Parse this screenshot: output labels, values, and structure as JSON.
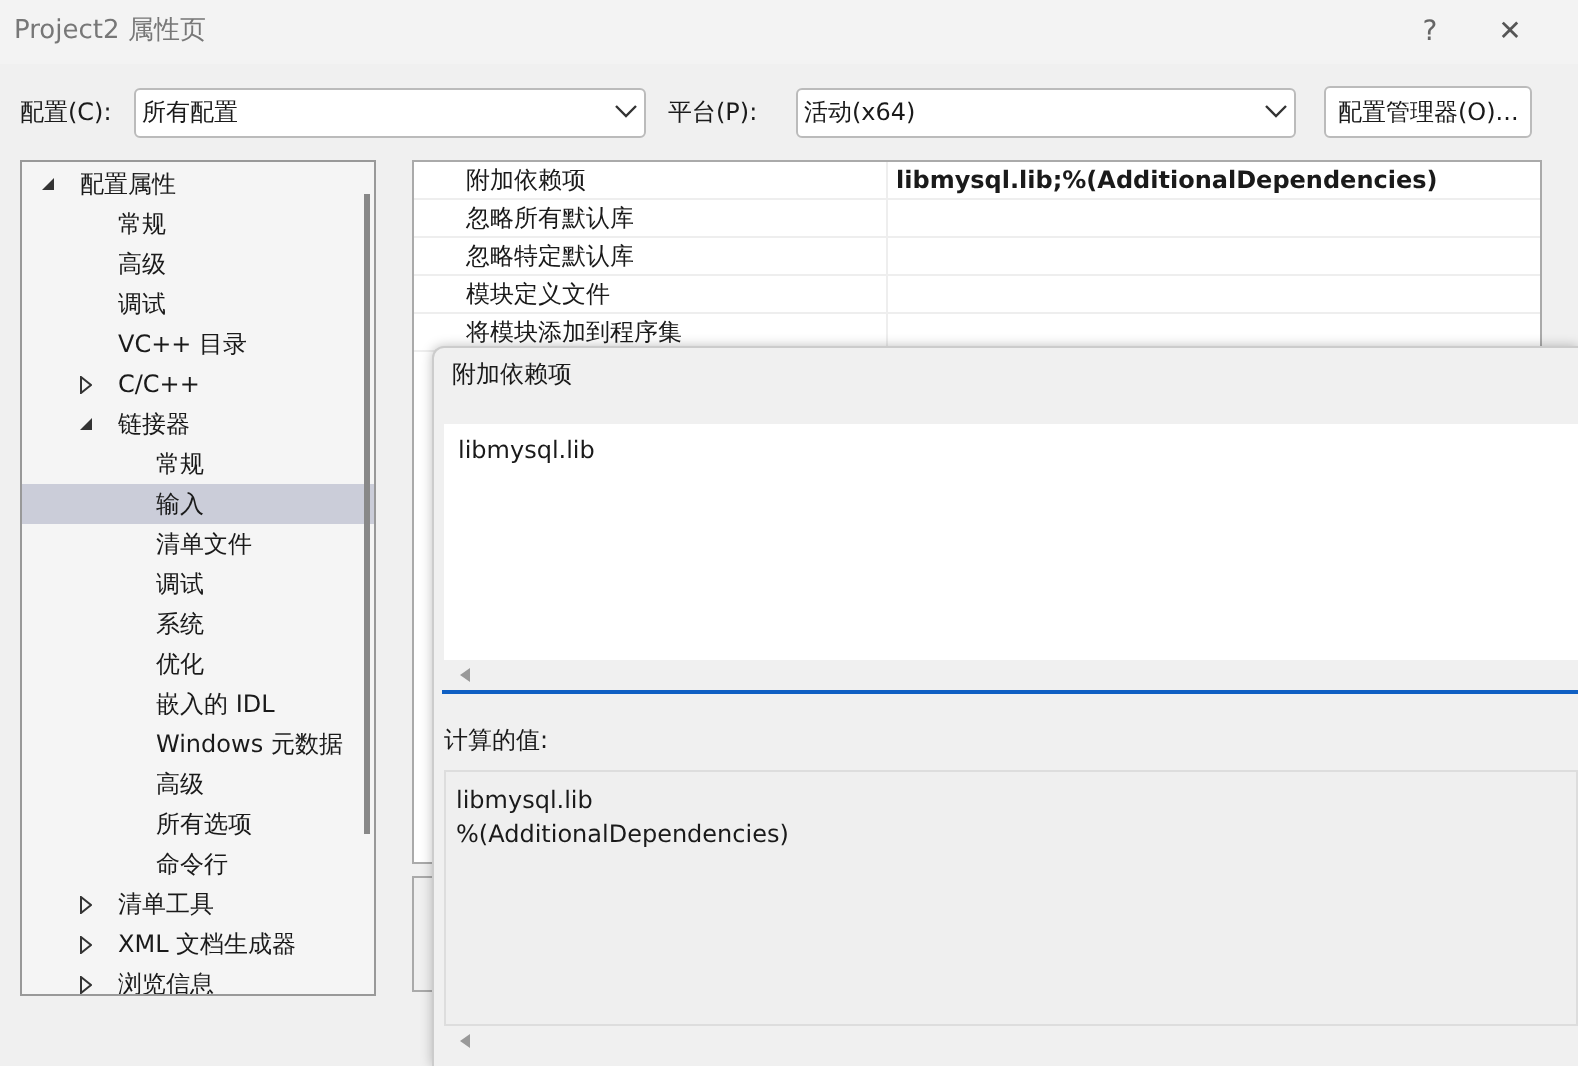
{
  "window": {
    "title": "Project2 属性页",
    "help": "?",
    "close": "✕"
  },
  "toolbar": {
    "config_label": "配置(C):",
    "config_value": "所有配置",
    "platform_label": "平台(P):",
    "platform_value": "活动(x64)",
    "manager_button": "配置管理器(O)..."
  },
  "tree": [
    {
      "label": "配置属性",
      "expanded": true,
      "selected": false,
      "children": [
        {
          "label": "常规",
          "selected": false
        },
        {
          "label": "高级",
          "selected": false
        },
        {
          "label": "调试",
          "selected": false
        },
        {
          "label": "VC++ 目录",
          "selected": false
        },
        {
          "label": "C/C++",
          "expanded": false,
          "selected": false
        },
        {
          "label": "链接器",
          "expanded": true,
          "selected": false,
          "children": [
            {
              "label": "常规",
              "selected": false
            },
            {
              "label": "输入",
              "selected": true
            },
            {
              "label": "清单文件",
              "selected": false
            },
            {
              "label": "调试",
              "selected": false
            },
            {
              "label": "系统",
              "selected": false
            },
            {
              "label": "优化",
              "selected": false
            },
            {
              "label": "嵌入的 IDL",
              "selected": false
            },
            {
              "label": "Windows 元数据",
              "selected": false
            },
            {
              "label": "高级",
              "selected": false
            },
            {
              "label": "所有选项",
              "selected": false
            },
            {
              "label": "命令行",
              "selected": false
            }
          ]
        },
        {
          "label": "清单工具",
          "expanded": false,
          "selected": false
        },
        {
          "label": "XML 文档生成器",
          "expanded": false,
          "selected": false
        },
        {
          "label": "浏览信息",
          "expanded": false,
          "selected": false
        }
      ]
    }
  ],
  "properties": [
    {
      "name": "附加依赖项",
      "value": "libmysql.lib;%(AdditionalDependencies)"
    },
    {
      "name": "忽略所有默认库"
    },
    {
      "name": "忽略特定默认库"
    },
    {
      "name": "模块定义文件"
    },
    {
      "name": "将模块添加到程序集"
    }
  ],
  "dialog": {
    "title": "附加依赖项",
    "input_value": "libmysql.lib",
    "computed_label": "计算的值:",
    "computed_lines": [
      "libmysql.lib",
      "%(AdditionalDependencies)"
    ]
  }
}
